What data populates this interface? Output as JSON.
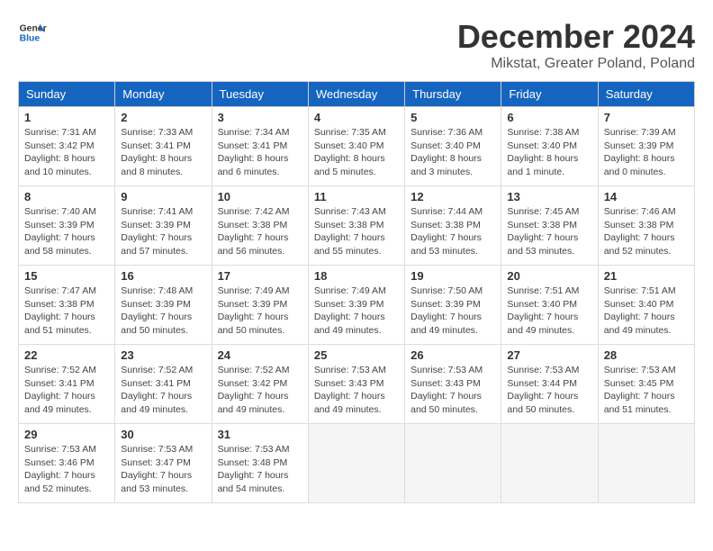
{
  "header": {
    "logo_line1": "General",
    "logo_line2": "Blue",
    "month": "December 2024",
    "location": "Mikstat, Greater Poland, Poland"
  },
  "weekdays": [
    "Sunday",
    "Monday",
    "Tuesday",
    "Wednesday",
    "Thursday",
    "Friday",
    "Saturday"
  ],
  "weeks": [
    [
      {
        "day": "1",
        "sunrise": "Sunrise: 7:31 AM",
        "sunset": "Sunset: 3:42 PM",
        "daylight": "Daylight: 8 hours and 10 minutes."
      },
      {
        "day": "2",
        "sunrise": "Sunrise: 7:33 AM",
        "sunset": "Sunset: 3:41 PM",
        "daylight": "Daylight: 8 hours and 8 minutes."
      },
      {
        "day": "3",
        "sunrise": "Sunrise: 7:34 AM",
        "sunset": "Sunset: 3:41 PM",
        "daylight": "Daylight: 8 hours and 6 minutes."
      },
      {
        "day": "4",
        "sunrise": "Sunrise: 7:35 AM",
        "sunset": "Sunset: 3:40 PM",
        "daylight": "Daylight: 8 hours and 5 minutes."
      },
      {
        "day": "5",
        "sunrise": "Sunrise: 7:36 AM",
        "sunset": "Sunset: 3:40 PM",
        "daylight": "Daylight: 8 hours and 3 minutes."
      },
      {
        "day": "6",
        "sunrise": "Sunrise: 7:38 AM",
        "sunset": "Sunset: 3:40 PM",
        "daylight": "Daylight: 8 hours and 1 minute."
      },
      {
        "day": "7",
        "sunrise": "Sunrise: 7:39 AM",
        "sunset": "Sunset: 3:39 PM",
        "daylight": "Daylight: 8 hours and 0 minutes."
      }
    ],
    [
      {
        "day": "8",
        "sunrise": "Sunrise: 7:40 AM",
        "sunset": "Sunset: 3:39 PM",
        "daylight": "Daylight: 7 hours and 58 minutes."
      },
      {
        "day": "9",
        "sunrise": "Sunrise: 7:41 AM",
        "sunset": "Sunset: 3:39 PM",
        "daylight": "Daylight: 7 hours and 57 minutes."
      },
      {
        "day": "10",
        "sunrise": "Sunrise: 7:42 AM",
        "sunset": "Sunset: 3:38 PM",
        "daylight": "Daylight: 7 hours and 56 minutes."
      },
      {
        "day": "11",
        "sunrise": "Sunrise: 7:43 AM",
        "sunset": "Sunset: 3:38 PM",
        "daylight": "Daylight: 7 hours and 55 minutes."
      },
      {
        "day": "12",
        "sunrise": "Sunrise: 7:44 AM",
        "sunset": "Sunset: 3:38 PM",
        "daylight": "Daylight: 7 hours and 53 minutes."
      },
      {
        "day": "13",
        "sunrise": "Sunrise: 7:45 AM",
        "sunset": "Sunset: 3:38 PM",
        "daylight": "Daylight: 7 hours and 53 minutes."
      },
      {
        "day": "14",
        "sunrise": "Sunrise: 7:46 AM",
        "sunset": "Sunset: 3:38 PM",
        "daylight": "Daylight: 7 hours and 52 minutes."
      }
    ],
    [
      {
        "day": "15",
        "sunrise": "Sunrise: 7:47 AM",
        "sunset": "Sunset: 3:38 PM",
        "daylight": "Daylight: 7 hours and 51 minutes."
      },
      {
        "day": "16",
        "sunrise": "Sunrise: 7:48 AM",
        "sunset": "Sunset: 3:39 PM",
        "daylight": "Daylight: 7 hours and 50 minutes."
      },
      {
        "day": "17",
        "sunrise": "Sunrise: 7:49 AM",
        "sunset": "Sunset: 3:39 PM",
        "daylight": "Daylight: 7 hours and 50 minutes."
      },
      {
        "day": "18",
        "sunrise": "Sunrise: 7:49 AM",
        "sunset": "Sunset: 3:39 PM",
        "daylight": "Daylight: 7 hours and 49 minutes."
      },
      {
        "day": "19",
        "sunrise": "Sunrise: 7:50 AM",
        "sunset": "Sunset: 3:39 PM",
        "daylight": "Daylight: 7 hours and 49 minutes."
      },
      {
        "day": "20",
        "sunrise": "Sunrise: 7:51 AM",
        "sunset": "Sunset: 3:40 PM",
        "daylight": "Daylight: 7 hours and 49 minutes."
      },
      {
        "day": "21",
        "sunrise": "Sunrise: 7:51 AM",
        "sunset": "Sunset: 3:40 PM",
        "daylight": "Daylight: 7 hours and 49 minutes."
      }
    ],
    [
      {
        "day": "22",
        "sunrise": "Sunrise: 7:52 AM",
        "sunset": "Sunset: 3:41 PM",
        "daylight": "Daylight: 7 hours and 49 minutes."
      },
      {
        "day": "23",
        "sunrise": "Sunrise: 7:52 AM",
        "sunset": "Sunset: 3:41 PM",
        "daylight": "Daylight: 7 hours and 49 minutes."
      },
      {
        "day": "24",
        "sunrise": "Sunrise: 7:52 AM",
        "sunset": "Sunset: 3:42 PM",
        "daylight": "Daylight: 7 hours and 49 minutes."
      },
      {
        "day": "25",
        "sunrise": "Sunrise: 7:53 AM",
        "sunset": "Sunset: 3:43 PM",
        "daylight": "Daylight: 7 hours and 49 minutes."
      },
      {
        "day": "26",
        "sunrise": "Sunrise: 7:53 AM",
        "sunset": "Sunset: 3:43 PM",
        "daylight": "Daylight: 7 hours and 50 minutes."
      },
      {
        "day": "27",
        "sunrise": "Sunrise: 7:53 AM",
        "sunset": "Sunset: 3:44 PM",
        "daylight": "Daylight: 7 hours and 50 minutes."
      },
      {
        "day": "28",
        "sunrise": "Sunrise: 7:53 AM",
        "sunset": "Sunset: 3:45 PM",
        "daylight": "Daylight: 7 hours and 51 minutes."
      }
    ],
    [
      {
        "day": "29",
        "sunrise": "Sunrise: 7:53 AM",
        "sunset": "Sunset: 3:46 PM",
        "daylight": "Daylight: 7 hours and 52 minutes."
      },
      {
        "day": "30",
        "sunrise": "Sunrise: 7:53 AM",
        "sunset": "Sunset: 3:47 PM",
        "daylight": "Daylight: 7 hours and 53 minutes."
      },
      {
        "day": "31",
        "sunrise": "Sunrise: 7:53 AM",
        "sunset": "Sunset: 3:48 PM",
        "daylight": "Daylight: 7 hours and 54 minutes."
      },
      null,
      null,
      null,
      null
    ]
  ]
}
